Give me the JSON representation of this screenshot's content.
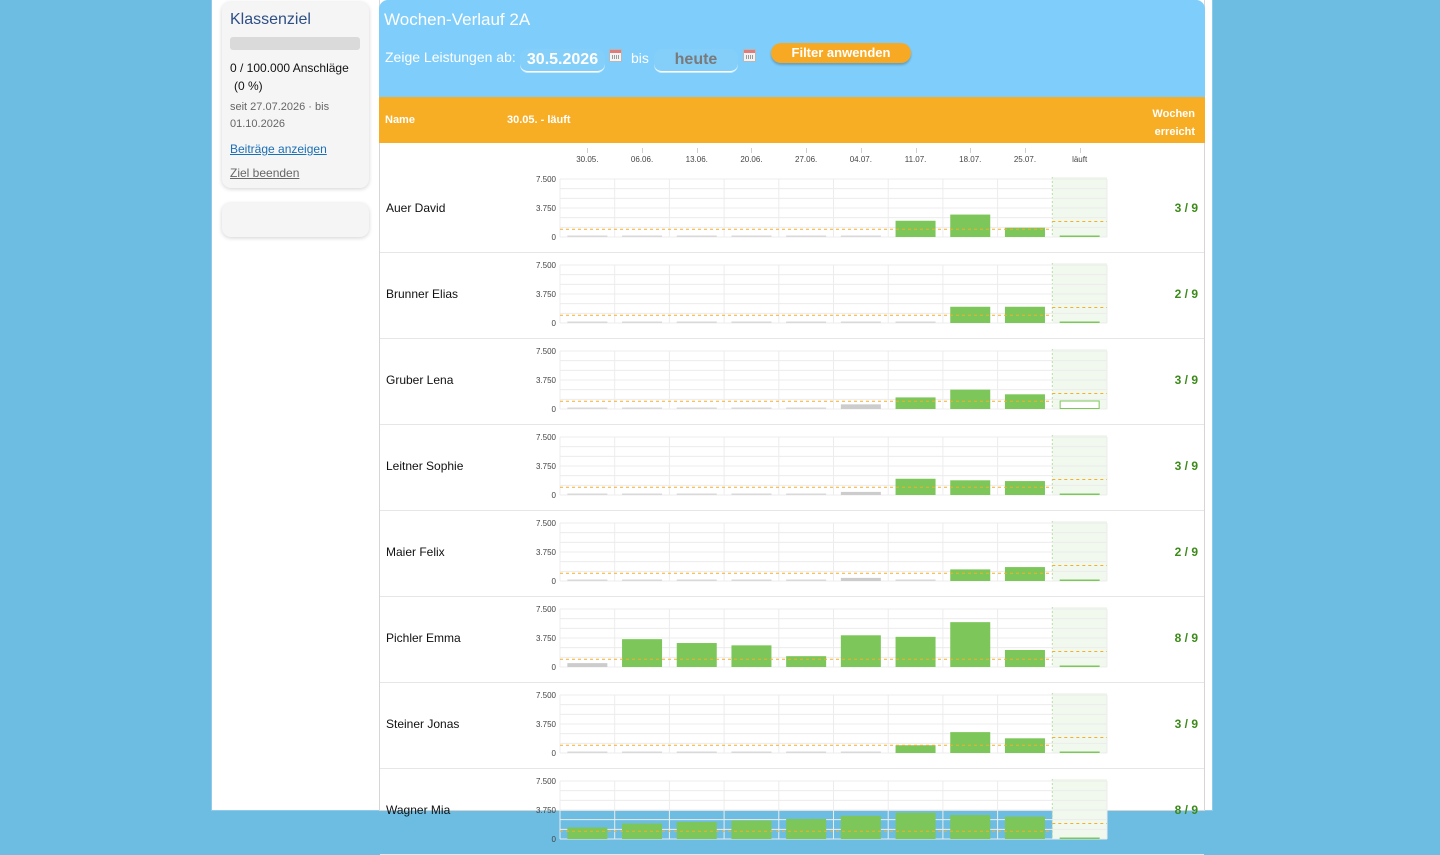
{
  "goal": {
    "title": "Klassenziel",
    "progress": 0,
    "count": "0 / 100.000 Anschläge",
    "percent": "(0 %)",
    "dates": "seit 27.07.2026 · bis 01.10.2026",
    "link_contributions": "Beiträge anzeigen",
    "link_end": "Ziel beenden"
  },
  "header": {
    "title": "Wochen-Verlauf 2A",
    "filter_label": "Zeige Leistungen ab:",
    "date_from": "30.5.2026",
    "bis": "bis",
    "date_to": "heute",
    "filter_button": "Filter anwenden"
  },
  "table": {
    "col_name": "Name",
    "col_range": "30.05. - läuft",
    "col_weeks": "Wochen erreicht"
  },
  "colors": {
    "achieved": "#7cc65a",
    "not_achieved": "#cccccc",
    "target_line": "#f7ae24",
    "current_week_bg": "#f1f9ee"
  },
  "chart_data": {
    "type": "bar",
    "categories": [
      "30.05.",
      "06.06.",
      "13.06.",
      "20.06.",
      "27.06.",
      "04.07.",
      "11.07.",
      "18.07.",
      "25.07.",
      "läuft"
    ],
    "ylim": [
      0,
      7500
    ],
    "yticks": [
      "7.500",
      "3.750",
      "0"
    ],
    "target": 1000,
    "current_target": 2000,
    "series": [
      {
        "name": "Auer David",
        "result": "3 / 9",
        "values": [
          0,
          0,
          0,
          0,
          0,
          0,
          2100,
          2900,
          1200,
          100
        ]
      },
      {
        "name": "Brunner Elias",
        "result": "2 / 9",
        "values": [
          0,
          0,
          0,
          0,
          0,
          0,
          0,
          2100,
          2100,
          100
        ]
      },
      {
        "name": "Gruber Lena",
        "result": "3 / 9",
        "values": [
          0,
          0,
          0,
          0,
          0,
          600,
          1500,
          2500,
          1900,
          1100
        ]
      },
      {
        "name": "Leitner Sophie",
        "result": "3 / 9",
        "values": [
          0,
          0,
          0,
          0,
          0,
          400,
          2100,
          1900,
          1800,
          100
        ]
      },
      {
        "name": "Maier Felix",
        "result": "2 / 9",
        "values": [
          0,
          0,
          0,
          0,
          0,
          400,
          0,
          1500,
          1800,
          100
        ]
      },
      {
        "name": "Pichler Emma",
        "result": "8 / 9",
        "values": [
          500,
          3600,
          3100,
          2800,
          1400,
          4100,
          3900,
          5800,
          2200,
          100
        ]
      },
      {
        "name": "Steiner Jonas",
        "result": "3 / 9",
        "values": [
          0,
          0,
          0,
          0,
          0,
          0,
          1000,
          2700,
          1900,
          100
        ]
      },
      {
        "name": "Wagner Mia",
        "result": "8 / 9",
        "values": [
          1500,
          2000,
          2200,
          2400,
          2600,
          3000,
          3400,
          3100,
          2900,
          100
        ]
      }
    ]
  }
}
